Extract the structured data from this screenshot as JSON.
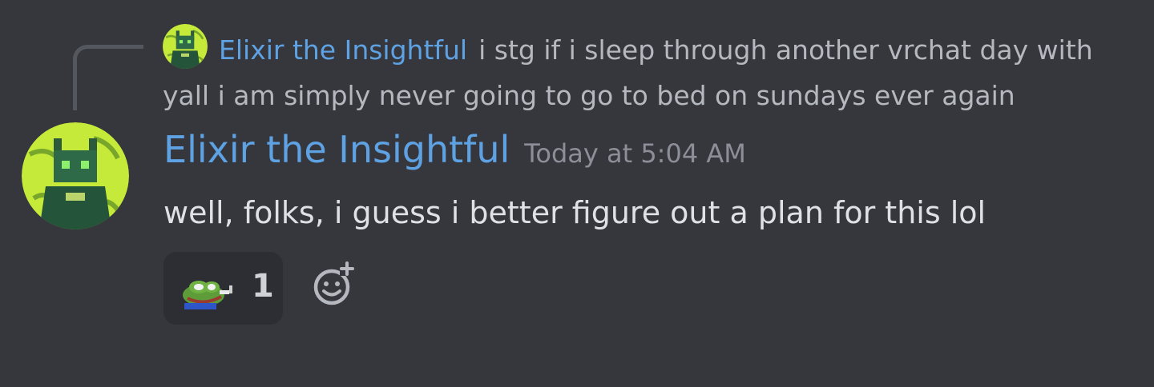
{
  "reply": {
    "author": "Elixir the Insightful",
    "text": "i stg if i sleep through another vrchat day with yall i am simply never going to go to bed on sundays ever again",
    "avatar_icon": "green-cat-creature-avatar"
  },
  "message": {
    "author": "Elixir the Insightful",
    "timestamp": "Today at 5:04 AM",
    "content": "well, folks, i guess i better figure out a plan for this lol",
    "avatar_icon": "green-cat-creature-avatar"
  },
  "reactions": [
    {
      "emoji": "pepe-frog-smoking-emoji",
      "count": "1"
    }
  ],
  "add_reaction_icon": "add-reaction-smiley-icon",
  "colors": {
    "background": "#36373d",
    "username": "#5ea2e3",
    "message_text": "#dfe1e5",
    "muted_text": "#8c8f97",
    "reaction_bg": "#2d2e33"
  }
}
